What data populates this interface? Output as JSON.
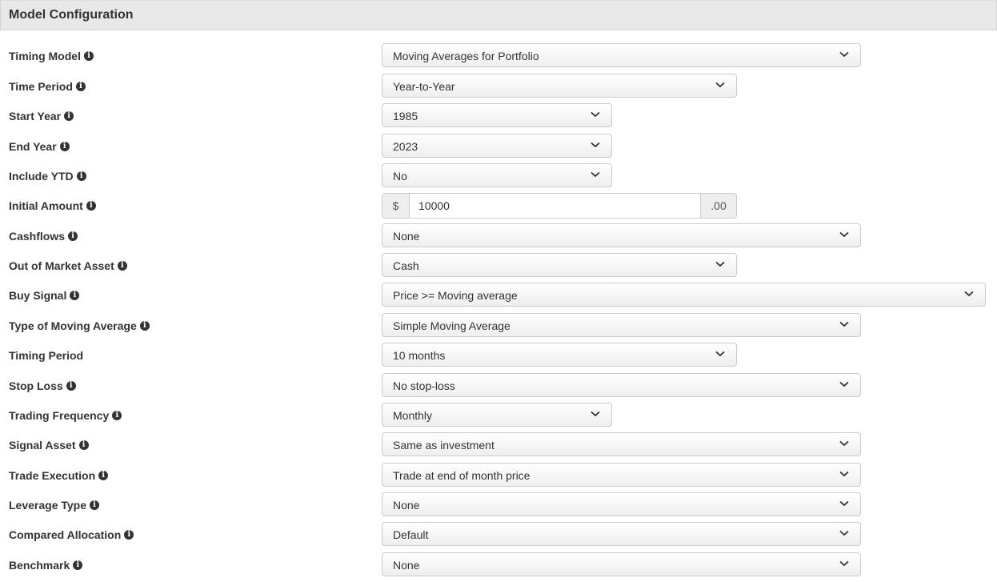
{
  "panel": {
    "title": "Model Configuration"
  },
  "fields": {
    "timing_model": {
      "label": "Timing Model",
      "value": "Moving Averages for Portfolio"
    },
    "time_period": {
      "label": "Time Period",
      "value": "Year-to-Year"
    },
    "start_year": {
      "label": "Start Year",
      "value": "1985"
    },
    "end_year": {
      "label": "End Year",
      "value": "2023"
    },
    "include_ytd": {
      "label": "Include YTD",
      "value": "No"
    },
    "initial_amount": {
      "label": "Initial Amount",
      "prefix": "$",
      "value": "10000",
      "suffix": ".00"
    },
    "cashflows": {
      "label": "Cashflows",
      "value": "None"
    },
    "out_of_market_asset": {
      "label": "Out of Market Asset",
      "value": "Cash"
    },
    "buy_signal": {
      "label": "Buy Signal",
      "value": "Price >= Moving average"
    },
    "type_of_moving_average": {
      "label": "Type of Moving Average",
      "value": "Simple Moving Average"
    },
    "timing_period": {
      "label": "Timing Period",
      "value": "10 months"
    },
    "stop_loss": {
      "label": "Stop Loss",
      "value": "No stop-loss"
    },
    "trading_frequency": {
      "label": "Trading Frequency",
      "value": "Monthly"
    },
    "signal_asset": {
      "label": "Signal Asset",
      "value": "Same as investment"
    },
    "trade_execution": {
      "label": "Trade Execution",
      "value": "Trade at end of month price"
    },
    "leverage_type": {
      "label": "Leverage Type",
      "value": "None"
    },
    "compared_allocation": {
      "label": "Compared Allocation",
      "value": "Default"
    },
    "benchmark": {
      "label": "Benchmark",
      "value": "None"
    }
  },
  "icons": {
    "info": "info-circle-icon",
    "dropdown": "chevron-down-icon"
  },
  "colors": {
    "header_bg": "#e8e8e8",
    "border": "#cccccc",
    "text": "#333333"
  }
}
